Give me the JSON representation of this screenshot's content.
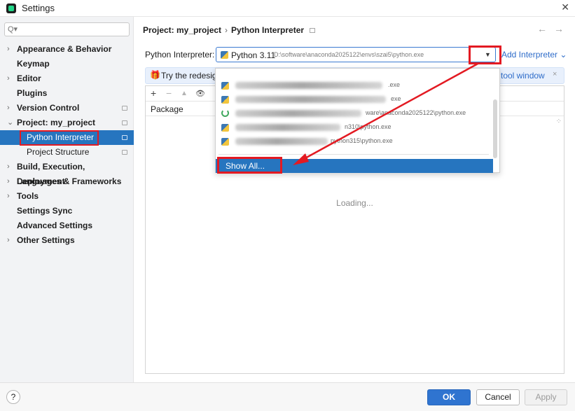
{
  "window": {
    "title": "Settings",
    "close_glyph": "✕",
    "app_icon": "pycharm-icon"
  },
  "sidebar": {
    "search_placeholder": "",
    "search_icon": "Q▾",
    "items": [
      {
        "label": "Appearance & Behavior",
        "expandable": true,
        "chevron": "›"
      },
      {
        "label": "Keymap",
        "expandable": false
      },
      {
        "label": "Editor",
        "expandable": true,
        "chevron": "›"
      },
      {
        "label": "Plugins",
        "expandable": false
      },
      {
        "label": "Version Control",
        "expandable": true,
        "chevron": "›"
      },
      {
        "label": "Project: my_project",
        "expandable": true,
        "chevron": "⌄",
        "expanded": true
      },
      {
        "label": "Python Interpreter",
        "selected": true
      },
      {
        "label": "Project Structure"
      },
      {
        "label": "Build, Execution, Deployment",
        "expandable": true,
        "chevron": "›"
      },
      {
        "label": "Languages & Frameworks",
        "expandable": true,
        "chevron": "›"
      },
      {
        "label": "Tools",
        "expandable": true,
        "chevron": "›"
      },
      {
        "label": "Settings Sync",
        "expandable": false
      },
      {
        "label": "Advanced Settings",
        "expandable": false
      },
      {
        "label": "Other Settings",
        "expandable": true,
        "chevron": "›"
      }
    ]
  },
  "main": {
    "breadcrumb": {
      "project": "Project: my_project",
      "separator": "›",
      "page": "Python Interpreter"
    },
    "nav_back": "←",
    "nav_forward": "→",
    "interpreter_label": "Python Interpreter:",
    "interpreter_version": "Python 3.11",
    "interpreter_path": "D:\\software\\anaconda2025122\\envs\\szai5\\python.exe",
    "dropdown_arrow": "▼",
    "add_interpreter": "Add Interpreter ⌄",
    "banner": {
      "icon": "🎁",
      "text": "Try the redesign",
      "link": "tool window",
      "close": "×"
    },
    "toolbar": {
      "add": "+",
      "remove": "−",
      "up": "▲",
      "show": "👁"
    },
    "package_column": "Package",
    "spinner": "⁘",
    "loading_text": "Loading..."
  },
  "dropdown": {
    "items": [
      {
        "icon": "python-icon",
        "visible_text": ".exe"
      },
      {
        "icon": "python-icon",
        "visible_text": "exe"
      },
      {
        "icon": "conda-spinner-icon",
        "visible_text": "ware\\anaconda2025122\\python.exe"
      },
      {
        "icon": "python-icon",
        "visible_text": "n310\\python.exe"
      },
      {
        "icon": "python-icon",
        "visible_text": "python315\\python.exe"
      }
    ],
    "show_all": "Show All..."
  },
  "colors": {
    "accent": "#2675bf",
    "annotation_red": "#e31a22",
    "link": "#2e6cc9",
    "banner_bg": "#e8f0fc"
  },
  "footer": {
    "help": "?",
    "ok": "OK",
    "cancel": "Cancel",
    "apply": "Apply"
  }
}
